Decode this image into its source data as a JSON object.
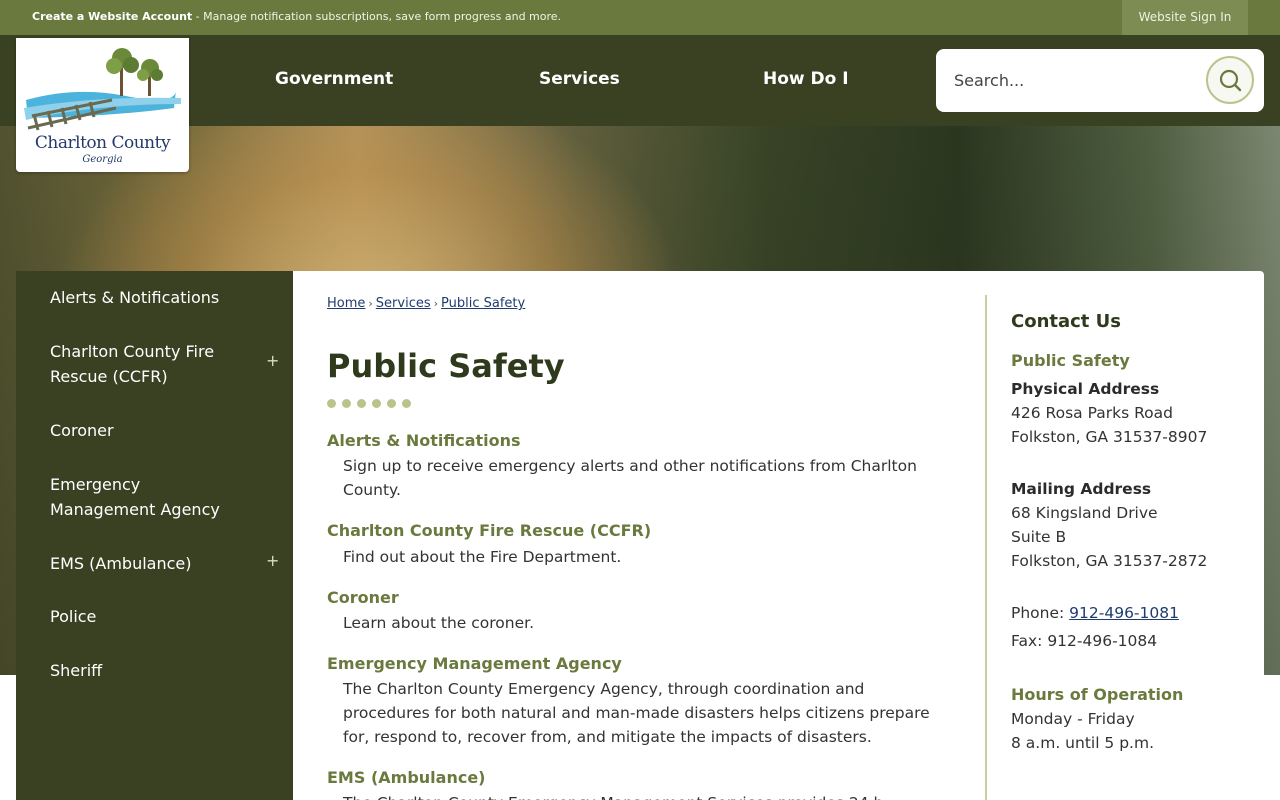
{
  "topbar": {
    "account_link": "Create a Website Account",
    "account_message": " - Manage notification subscriptions, save form progress and more.",
    "sign_in": "Website Sign In"
  },
  "logo": {
    "name": "Charlton County",
    "subtitle": "Georgia"
  },
  "nav": [
    "Government",
    "Services",
    "How Do I"
  ],
  "search": {
    "placeholder": "Search...",
    "icon": "search-icon"
  },
  "sidebar": {
    "items": [
      {
        "label": "Alerts & Notifications",
        "expandable": false
      },
      {
        "label": "Charlton County Fire Rescue (CCFR)",
        "expandable": true
      },
      {
        "label": "Coroner",
        "expandable": false
      },
      {
        "label": "Emergency Management Agency",
        "expandable": false
      },
      {
        "label": "EMS (Ambulance)",
        "expandable": true
      },
      {
        "label": "Police",
        "expandable": false
      },
      {
        "label": "Sheriff",
        "expandable": false
      }
    ],
    "expand_symbol": "+"
  },
  "breadcrumb": [
    "Home",
    "Services",
    "Public Safety"
  ],
  "page_title": "Public Safety",
  "sections": [
    {
      "title": "Alerts & Notifications",
      "desc": "Sign up to receive emergency alerts and other notifications from Charlton County."
    },
    {
      "title": "Charlton County Fire Rescue (CCFR)",
      "desc": "Find out about the Fire Department."
    },
    {
      "title": "Coroner",
      "desc": "Learn about the coroner."
    },
    {
      "title": "Emergency Management Agency",
      "desc": "The Charlton County Emergency Agency, through coordination and procedures for both natural and man-made disasters helps citizens prepare for, respond to, recover from, and mitigate the impacts of disasters."
    },
    {
      "title": "EMS (Ambulance)",
      "desc": "The Charlton County Emergency Management Services provides 24 h"
    }
  ],
  "contact": {
    "title": "Contact Us",
    "department": "Public Safety",
    "physical_label": "Physical Address",
    "physical_lines": [
      "426 Rosa Parks Road",
      "Folkston, GA 31537-8907"
    ],
    "mailing_label": "Mailing Address",
    "mailing_lines": [
      "68 Kingsland Drive",
      "Suite B",
      "Folkston, GA 31537-2872"
    ],
    "phone_label": "Phone: ",
    "phone": "912-496-1081",
    "fax": "Fax: 912-496-1084",
    "hours_title": "Hours of Operation",
    "hours_lines": [
      "Monday - Friday",
      "8 a.m. until 5 p.m."
    ]
  },
  "colors": {
    "olive_dark": "#3a4123",
    "olive": "#6a7a3e",
    "accent_light": "#b9c48d",
    "link": "#1f3c6e"
  }
}
